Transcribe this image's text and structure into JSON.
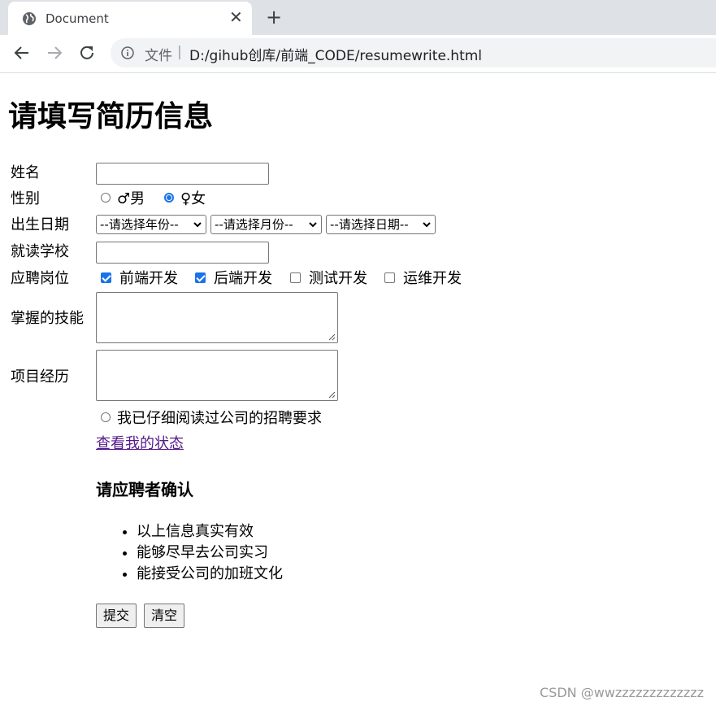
{
  "browser": {
    "tab_title": "Document",
    "address_scheme": "文件",
    "address_separator": "|",
    "url": "D:/gihub创库/前端_CODE/resumewrite.html"
  },
  "page": {
    "heading": "请填写简历信息",
    "fields": {
      "name_label": "姓名",
      "name_value": "",
      "gender_label": "性别",
      "gender_male": "♂男",
      "gender_female": "♀女",
      "gender_selected": "female",
      "birth_label": "出生日期",
      "birth_year": "--请选择年份--",
      "birth_month": "--请选择月份--",
      "birth_day": "--请选择日期--",
      "school_label": "就读学校",
      "school_value": "",
      "position_label": "应聘岗位",
      "positions": [
        {
          "label": "前端开发",
          "checked": true
        },
        {
          "label": "后端开发",
          "checked": true
        },
        {
          "label": "测试开发",
          "checked": false
        },
        {
          "label": "运维开发",
          "checked": false
        }
      ],
      "skills_label": "掌握的技能",
      "project_label": "项目经历",
      "agree_label": "我已仔细阅读过公司的招聘要求"
    },
    "status_link": "查看我的状态",
    "confirm_heading": "请应聘者确认",
    "confirm_items": [
      "以上信息真实有效",
      "能够尽早去公司实习",
      "能接受公司的加班文化"
    ],
    "submit_label": "提交",
    "reset_label": "清空"
  },
  "watermark": "CSDN @wwzzzzzzzzzzzzz",
  "colors": {
    "accent": "#1a73e8",
    "link_visited": "#551a8b",
    "tabbar": "#dee1e6"
  },
  "icons": [
    "globe-icon",
    "close-icon",
    "plus-icon",
    "back-arrow-icon",
    "forward-arrow-icon",
    "reload-icon",
    "info-icon",
    "chevron-down-icon",
    "resize-grip-icon"
  ]
}
